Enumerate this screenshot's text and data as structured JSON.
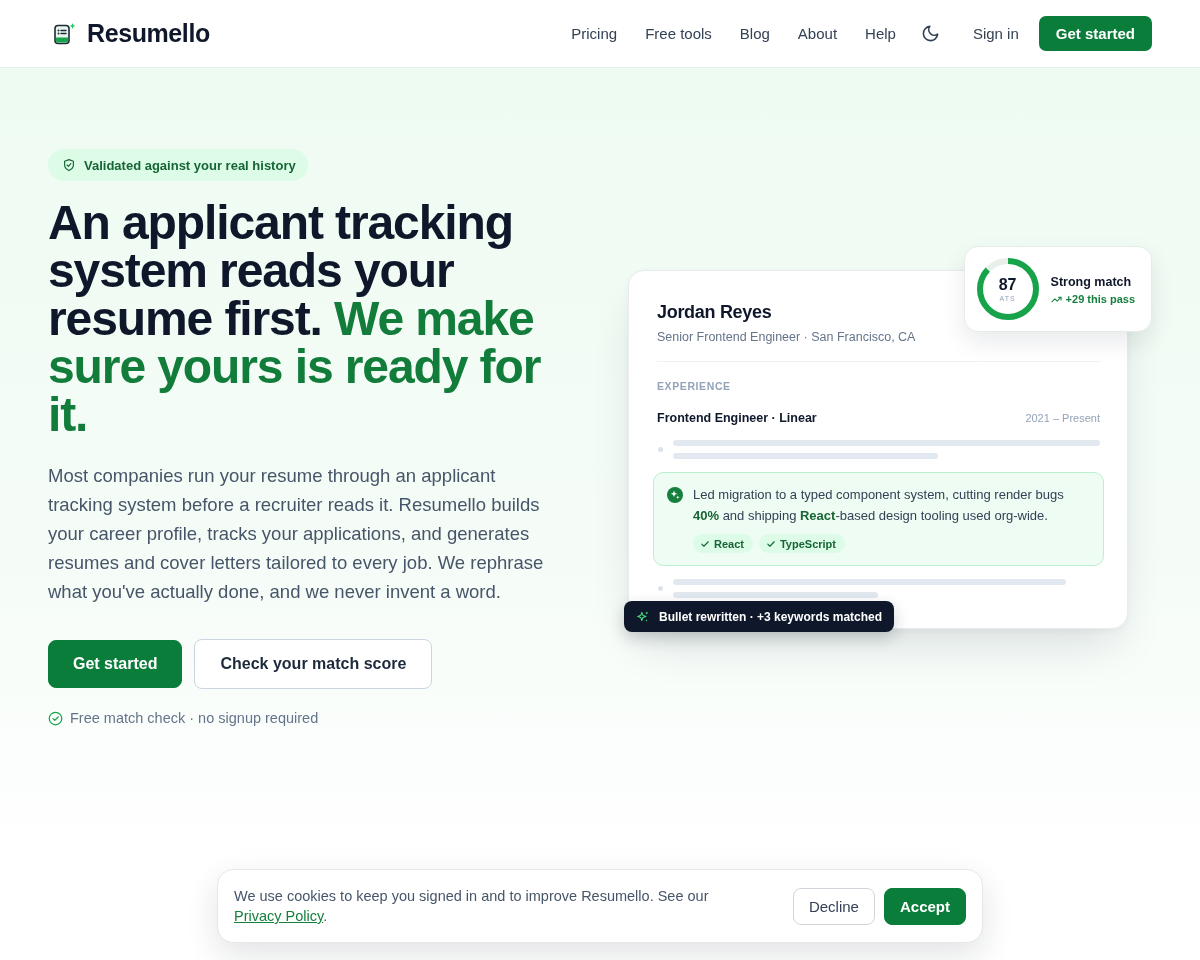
{
  "header": {
    "logo": "Resumello",
    "nav": [
      "Pricing",
      "Free tools",
      "Blog",
      "About",
      "Help"
    ],
    "sign_in": "Sign in",
    "cta": "Get started"
  },
  "hero": {
    "badge": "Validated against your real history",
    "headline": "An applicant tracking system reads your resume first.",
    "headline_highlight": "We make sure yours is ready for it.",
    "description": "Most companies run your resume through an applicant tracking system before a recruiter reads it. Resumello builds your career profile, tracks your applications, and generates resumes and cover letters tailored to every job. We rephrase what you've actually done, and we never invent a word.",
    "buttons": [
      {
        "label": "Get started",
        "kind": "primary"
      },
      {
        "label": "Check your match score",
        "kind": "secondary"
      }
    ],
    "note": "Free match check · no signup required"
  },
  "resume_card": {
    "name": "Jordan Reyes",
    "subtitle": "Senior Frontend Engineer · San Francisco, CA",
    "section": "EXPERIENCE",
    "role": "Frontend Engineer · Linear",
    "dates": "2021 – Present",
    "bullets": [
      {
        "kind": "placeholder"
      },
      {
        "kind": "rewritten",
        "text": "Led migration to a typed component system, cutting render bugs **40%** and shipping **React**-based design tooling used org-wide.",
        "tags": [
          "React",
          "TypeScript"
        ]
      },
      {
        "kind": "placeholder"
      }
    ]
  },
  "score_card": {
    "score": "87",
    "score_label": "ATS",
    "level": 0.87,
    "title": "Strong match",
    "delta": "+29 this pass"
  },
  "toast": {
    "text": "Bullet rewritten · +3 keywords matched"
  },
  "cookie_banner": {
    "text": "We use cookies to keep you signed in and to improve Resumello. See our",
    "link": "Privacy Policy",
    "end": ".",
    "buttons": [
      {
        "label": "Decline",
        "kind": "secondary"
      },
      {
        "label": "Accept",
        "kind": "primary"
      }
    ]
  }
}
